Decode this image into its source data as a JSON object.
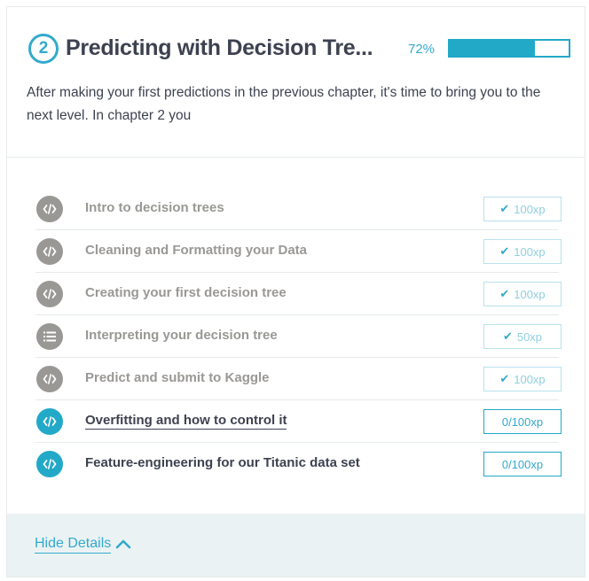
{
  "chapter": {
    "number": "2",
    "title": "Predicting with Decision Tre...",
    "progress_label": "72%",
    "progress_value": 0.72,
    "description": "After making your first predictions in the previous chapter, it's time to bring you to the next level. In chapter 2 you"
  },
  "exercises": [
    {
      "title": "Intro to decision trees",
      "xp": "100xp",
      "status": "done",
      "icon": "code-icon"
    },
    {
      "title": "Cleaning and Formatting your Data",
      "xp": "100xp",
      "status": "done",
      "icon": "code-icon"
    },
    {
      "title": "Creating your first decision tree",
      "xp": "100xp",
      "status": "done",
      "icon": "code-icon"
    },
    {
      "title": "Interpreting your decision tree",
      "xp": "50xp",
      "status": "done",
      "icon": "list-icon"
    },
    {
      "title": "Predict and submit to Kaggle",
      "xp": "100xp",
      "status": "done",
      "icon": "code-icon"
    },
    {
      "title": "Overfitting and how to control it",
      "xp": "0/100xp",
      "status": "todo",
      "icon": "code-icon"
    },
    {
      "title": "Feature-engineering for our Titanic data set",
      "xp": "0/100xp",
      "status": "todo",
      "icon": "code-icon"
    }
  ],
  "footer": {
    "hide_details_label": "Hide Details"
  },
  "colors": {
    "accent": "#33aacc",
    "progress": "#22a9c8",
    "done_gray": "#9a9895",
    "footer_bg": "#ebf2f4"
  }
}
